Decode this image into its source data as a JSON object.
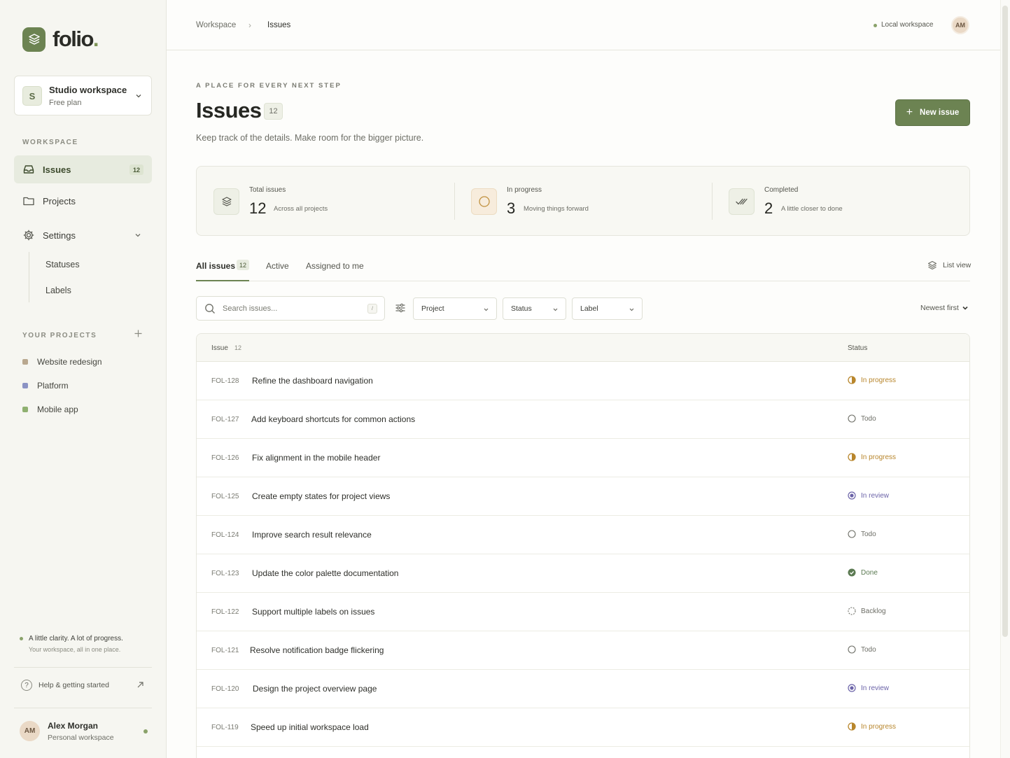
{
  "brand": {
    "name": "folio",
    "dot": ".",
    "accent": "#6c8352"
  },
  "workspace": {
    "avatar": "S",
    "name": "Studio workspace",
    "plan": "Free plan"
  },
  "sidebar": {
    "workspace_label": "WORKSPACE",
    "nav": {
      "issues": {
        "label": "Issues",
        "badge": "12",
        "icon": "inbox-icon"
      },
      "projects": {
        "label": "Projects",
        "icon": "folder-icon"
      },
      "settings": {
        "label": "Settings",
        "icon": "gear-icon"
      }
    },
    "settings_sub": [
      "Statuses",
      "Labels"
    ],
    "projects_label": "YOUR PROJECTS",
    "projects": [
      {
        "name": "Website redesign",
        "color": "#b9a88f"
      },
      {
        "name": "Platform",
        "color": "#8b93c4"
      },
      {
        "name": "Mobile app",
        "color": "#8fb070"
      }
    ],
    "tagline": "A little clarity. A lot of progress.",
    "tagline_sub": "Your workspace, all in one place.",
    "help": "Help & getting started",
    "user": {
      "initials": "AM",
      "name": "Alex Morgan",
      "workspace": "Personal workspace"
    }
  },
  "topbar": {
    "breadcrumb": [
      "Workspace",
      "Issues"
    ],
    "breadcrumb_sep": "›",
    "local": "Local workspace",
    "avatar": "AM"
  },
  "header": {
    "eyebrow": "A PLACE FOR EVERY NEXT STEP",
    "title": "Issues",
    "count": "12",
    "subtitle": "Keep track of the details. Make room for the bigger picture.",
    "new_issue": "New issue"
  },
  "stats": [
    {
      "label": "Total issues",
      "value": "12",
      "sub": "Across all projects"
    },
    {
      "label": "In progress",
      "value": "3",
      "sub": "Moving things forward"
    },
    {
      "label": "Completed",
      "value": "2",
      "sub": "A little closer to done"
    }
  ],
  "tabs": {
    "all": "All issues",
    "all_count": "12",
    "active": "Active",
    "assigned": "Assigned to me",
    "list_view": "List view"
  },
  "filters": {
    "search_placeholder": "Search issues...",
    "kbd": "/",
    "project": "Project",
    "status": "Status",
    "label": "Label",
    "sort": "Newest first"
  },
  "table": {
    "col_issue": "Issue",
    "col_count": "12",
    "col_status": "Status",
    "rows": [
      {
        "id": "FOL-128",
        "title": "Refine the dashboard navigation",
        "status": "In progress",
        "kind": "progress"
      },
      {
        "id": "FOL-127",
        "title": "Add keyboard shortcuts for common actions",
        "status": "Todo",
        "kind": "todo"
      },
      {
        "id": "FOL-126",
        "title": "Fix alignment in the mobile header",
        "status": "In progress",
        "kind": "progress"
      },
      {
        "id": "FOL-125",
        "title": "Create empty states for project views",
        "status": "In review",
        "kind": "review"
      },
      {
        "id": "FOL-124",
        "title": "Improve search result relevance",
        "status": "Todo",
        "kind": "todo"
      },
      {
        "id": "FOL-123",
        "title": "Update the color palette documentation",
        "status": "Done",
        "kind": "done"
      },
      {
        "id": "FOL-122",
        "title": "Support multiple labels on issues",
        "status": "Backlog",
        "kind": "backlog"
      },
      {
        "id": "FOL-121",
        "title": "Resolve notification badge flickering",
        "status": "Todo",
        "kind": "todo"
      },
      {
        "id": "FOL-120",
        "title": "Design the project overview page",
        "status": "In review",
        "kind": "review"
      },
      {
        "id": "FOL-119",
        "title": "Speed up initial workspace load",
        "status": "In progress",
        "kind": "progress"
      }
    ]
  },
  "status_colors": {
    "progress": "#b8862c",
    "todo": "#6d6e66",
    "review": "#6b63a8",
    "done": "#5b7a52",
    "backlog": "#6d6e66"
  }
}
